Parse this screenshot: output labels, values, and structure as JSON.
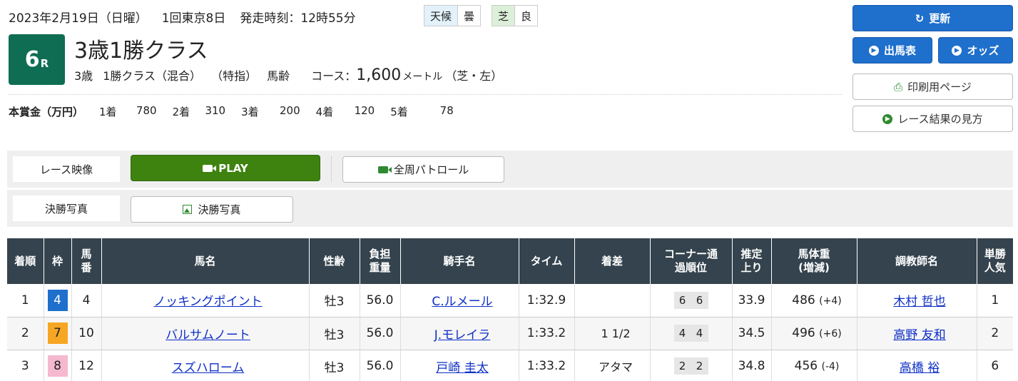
{
  "header": {
    "date": "2023年2月19日（日曜）",
    "meeting": "1回東京8日",
    "start_time": "発走時刻：12時55分",
    "weather_label": "天候",
    "weather_value": "曇",
    "track_label": "芝",
    "track_value": "良"
  },
  "race": {
    "number": "6",
    "r_suffix": "R",
    "name": "3歳1勝クラス",
    "age": "3歳",
    "class": "1勝クラス（混合）",
    "special": "（特指）",
    "weight_rule": "馬齢",
    "course_label": "コース：",
    "distance": "1,600",
    "distance_unit": "メートル",
    "surface": "（芝・左）"
  },
  "prize": {
    "label": "本賞金（万円）",
    "items": [
      {
        "place": "1着",
        "value": "780"
      },
      {
        "place": "2着",
        "value": "310"
      },
      {
        "place": "3着",
        "value": "200"
      },
      {
        "place": "4着",
        "value": "120"
      },
      {
        "place": "5着",
        "value": "78"
      }
    ]
  },
  "buttons": {
    "refresh": "更新",
    "entries": "出馬表",
    "odds": "オッズ",
    "print": "印刷用ページ",
    "guide": "レース結果の見方"
  },
  "media": {
    "video_label": "レース映像",
    "play": "PLAY",
    "patrol": "全周パトロール",
    "photo_label": "決勝写真",
    "photo_button": "決勝写真"
  },
  "table": {
    "headers": [
      "着順",
      "枠",
      "馬番",
      "馬名",
      "性齢",
      "負担重量",
      "騎手名",
      "タイム",
      "着差",
      "コーナー通過順位",
      "推定上り",
      "馬体重(増減)",
      "調教師名",
      "単勝人気"
    ],
    "rows": [
      {
        "place": "1",
        "waku": "4",
        "num": "4",
        "horse": "ノッキングポイント",
        "sex_age": "牡3",
        "weight": "56.0",
        "jockey": "C.ルメール",
        "time": "1:32.9",
        "margin": "",
        "c1": "6",
        "c2": "6",
        "last3f": "33.9",
        "bw": "486",
        "bw_diff": "(+4)",
        "trainer": "木村 哲也",
        "pop": "1"
      },
      {
        "place": "2",
        "waku": "7",
        "num": "10",
        "horse": "バルサムノート",
        "sex_age": "牡3",
        "weight": "56.0",
        "jockey": "J.モレイラ",
        "time": "1:33.2",
        "margin": "1 1/2",
        "c1": "4",
        "c2": "4",
        "last3f": "34.5",
        "bw": "496",
        "bw_diff": "(+6)",
        "trainer": "高野 友和",
        "pop": "2"
      },
      {
        "place": "3",
        "waku": "8",
        "num": "12",
        "horse": "スズハローム",
        "sex_age": "牡3",
        "weight": "56.0",
        "jockey": "戸崎 圭太",
        "time": "1:33.2",
        "margin": "アタマ",
        "c1": "2",
        "c2": "2",
        "last3f": "34.8",
        "bw": "456",
        "bw_diff": "(-4)",
        "trainer": "高橋 裕",
        "pop": "6"
      }
    ]
  },
  "colors": {
    "race_badge": "#0e6d52",
    "primary_button": "#1f6fcc",
    "play_button": "#3e8210",
    "table_header": "#34434d",
    "waku4": "#1f6fcc",
    "waku7": "#f6a623",
    "waku8": "#f4b8cf"
  }
}
